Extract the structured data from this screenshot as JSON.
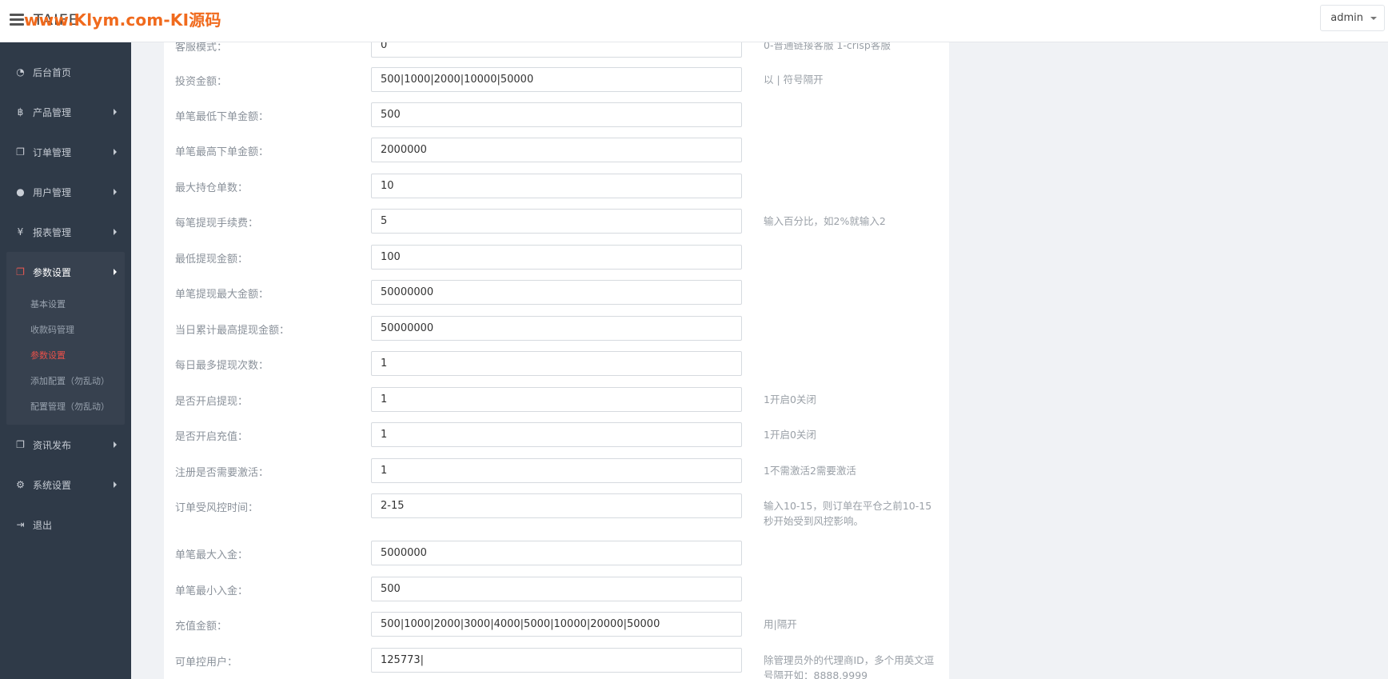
{
  "header": {
    "logo": "TAIFE",
    "watermark": "www.Klym.com-KI源码",
    "user": "admin"
  },
  "sidebar": {
    "items": [
      {
        "label": "后台首页",
        "icon": "dashboard-icon"
      },
      {
        "label": "产品管理",
        "icon": "bitcoin-icon"
      },
      {
        "label": "订单管理",
        "icon": "copy-icon"
      },
      {
        "label": "用户管理",
        "icon": "user-icon"
      },
      {
        "label": "报表管理",
        "icon": "yen-icon"
      }
    ],
    "active_group": {
      "label": "参数设置",
      "icon": "copy-icon",
      "children": [
        "基本设置",
        "收款码管理",
        "参数设置",
        "添加配置（勿乱动）",
        "配置管理（勿乱动）"
      ],
      "active_child": "参数设置"
    },
    "items_after": [
      {
        "label": "资讯发布",
        "icon": "copy-icon"
      },
      {
        "label": "系统设置",
        "icon": "cogs-icon"
      },
      {
        "label": "退出",
        "icon": "sign-out-icon"
      }
    ]
  },
  "form": {
    "rows": [
      {
        "label": "客服模式：",
        "value": "0",
        "hint": "0-普通链接客服 1-crisp客服"
      },
      {
        "label": "投资金额：",
        "value": "500|1000|2000|10000|50000",
        "hint": "以 | 符号隔开"
      },
      {
        "label": "单笔最低下单金额：",
        "value": "500",
        "hint": ""
      },
      {
        "label": "单笔最高下单金额：",
        "value": "2000000",
        "hint": ""
      },
      {
        "label": "最大持仓单数：",
        "value": "10",
        "hint": ""
      },
      {
        "label": "每笔提现手续费：",
        "value": "5",
        "hint": "输入百分比，如2%就输入2"
      },
      {
        "label": "最低提现金额：",
        "value": "100",
        "hint": ""
      },
      {
        "label": "单笔提现最大金额：",
        "value": "50000000",
        "hint": ""
      },
      {
        "label": "当日累计最高提现金额：",
        "value": "50000000",
        "hint": ""
      },
      {
        "label": "每日最多提现次数：",
        "value": "1",
        "hint": ""
      },
      {
        "label": "是否开启提现：",
        "value": "1",
        "hint": "1开启0关闭"
      },
      {
        "label": "是否开启充值：",
        "value": "1",
        "hint": "1开启0关闭"
      },
      {
        "label": "注册是否需要激活：",
        "value": "1",
        "hint": "1不需激活2需要激活"
      },
      {
        "label": "订单受风控时间：",
        "value": "2-15",
        "hint": "输入10-15，则订单在平仓之前10-15秒开始受到风控影响。"
      },
      {
        "label": "单笔最大入金：",
        "value": "5000000",
        "hint": ""
      },
      {
        "label": "单笔最小入金：",
        "value": "500",
        "hint": ""
      },
      {
        "label": "充值金额：",
        "value": "500|1000|2000|3000|4000|5000|10000|20000|50000",
        "hint": "用|隔开"
      },
      {
        "label": "可单控用户：",
        "value": "125773|",
        "hint": "除管理员外的代理商ID，多个用英文逗号隔开如：8888,9999"
      }
    ]
  }
}
